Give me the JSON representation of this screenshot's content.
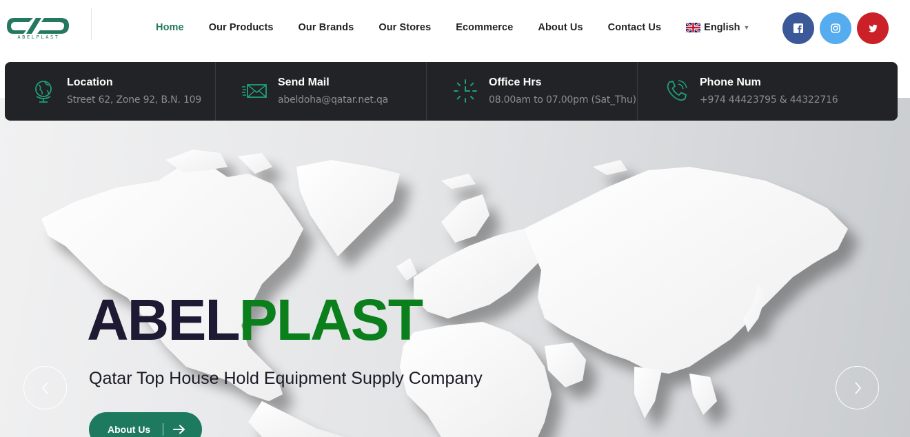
{
  "logo": {
    "mark_text": "ABELPLAST",
    "brand_color": "#23785f"
  },
  "nav": {
    "items": [
      {
        "label": "Home",
        "active": true
      },
      {
        "label": "Our Products"
      },
      {
        "label": "Our Brands"
      },
      {
        "label": "Our Stores"
      },
      {
        "label": "Ecommerce"
      },
      {
        "label": "About Us"
      },
      {
        "label": "Contact Us"
      }
    ],
    "language": {
      "label": "English",
      "flag_icon": "uk-flag-icon"
    }
  },
  "social": [
    {
      "name": "facebook-icon",
      "color": "#3b5998"
    },
    {
      "name": "instagram-icon",
      "color": "#55acee"
    },
    {
      "name": "twitter-icon",
      "color": "#cb2027"
    }
  ],
  "info": [
    {
      "title": "Location",
      "value": "Street 62, Zone 92, B.N. 109",
      "icon": "globe-icon"
    },
    {
      "title": "Send Mail",
      "value": "abeldoha@qatar.net.qa",
      "icon": "mail-icon"
    },
    {
      "title": "Office Hrs",
      "value": "08.00am to 07.00pm (Sat_Thu)",
      "icon": "clock-icon"
    },
    {
      "title": "Phone Num",
      "value": "+974 44423795 & 44322716",
      "icon": "phone-icon"
    }
  ],
  "hero": {
    "title_part1": "ABEL",
    "title_part2": "PLAST",
    "title_color1": "#1f1a33",
    "title_color2": "#0a7f1c",
    "tagline": "Qatar Top House Hold Equipment Supply Company",
    "cta_label": "About Us",
    "cta_color": "#1e7a5f"
  }
}
